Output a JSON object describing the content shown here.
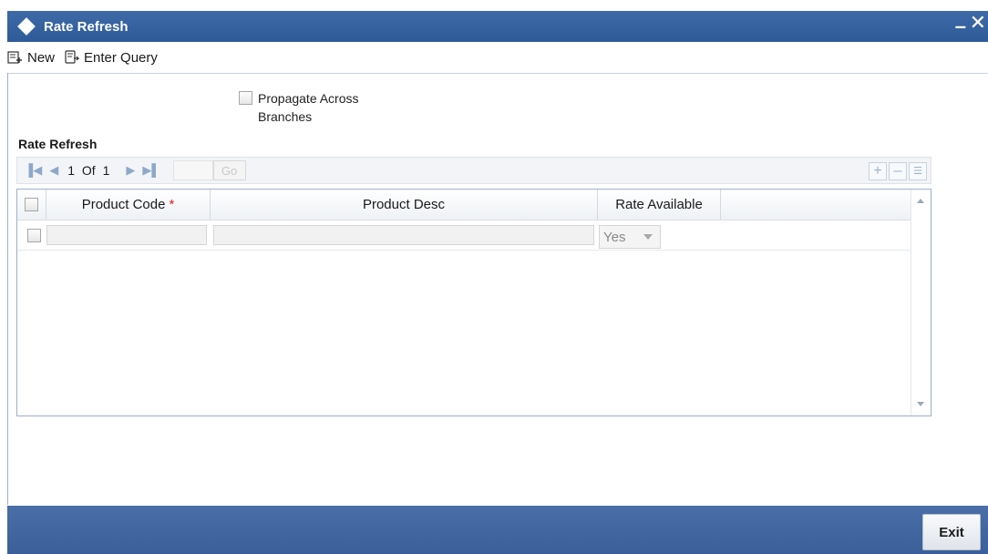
{
  "window": {
    "title": "Rate Refresh",
    "minimize_label": "–",
    "close_label": "✕"
  },
  "toolbar": {
    "new_label": "New",
    "enter_query_label": "Enter Query"
  },
  "form": {
    "propagate_label": "Propagate Across Branches",
    "propagate_checked": false
  },
  "section": {
    "title": "Rate Refresh"
  },
  "pager": {
    "current": "1",
    "of_label": "Of",
    "total": "1",
    "go_label": "Go"
  },
  "grid": {
    "columns": [
      "Product Code",
      "Product Desc",
      "Rate Available"
    ],
    "required_marker": "*",
    "rows": [
      {
        "product_code": "",
        "product_desc": "",
        "rate_available": "Yes"
      }
    ]
  },
  "footer": {
    "exit_label": "Exit"
  }
}
